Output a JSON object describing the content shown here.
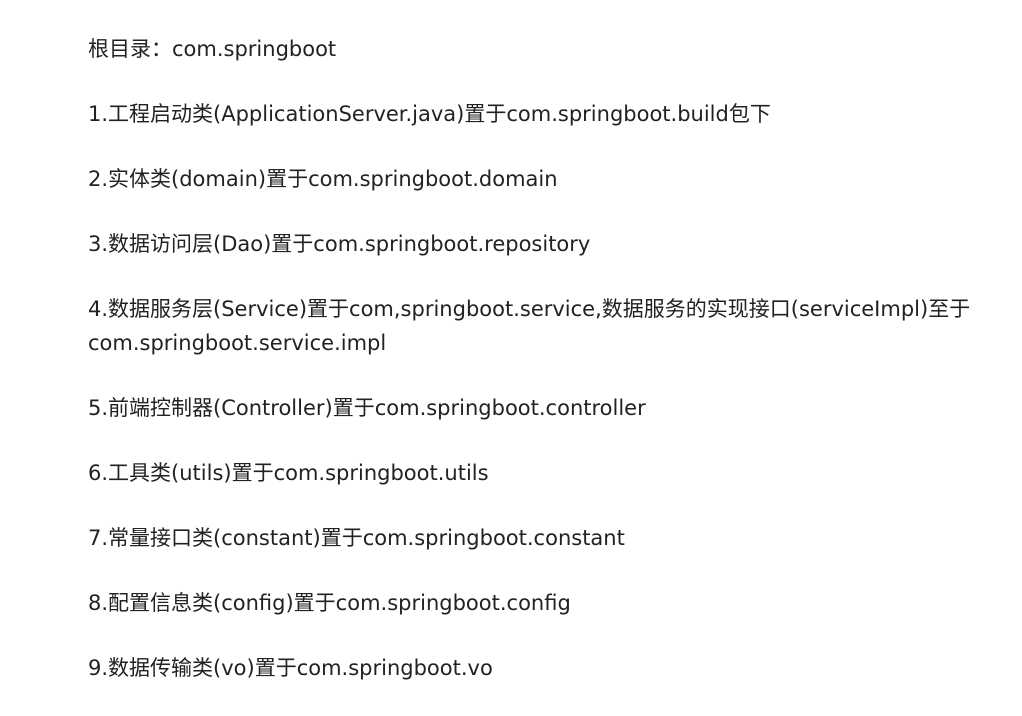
{
  "document": {
    "root_line": "根目录：com.springboot",
    "items": [
      "1.工程启动类(ApplicationServer.java)置于com.springboot.build包下",
      "2.实体类(domain)置于com.springboot.domain",
      "3.数据访问层(Dao)置于com.springboot.repository",
      "4.数据服务层(Service)置于com,springboot.service,数据服务的实现接口(serviceImpl)至于com.springboot.service.impl",
      "5.前端控制器(Controller)置于com.springboot.controller",
      "6.工具类(utils)置于com.springboot.utils",
      "7.常量接口类(constant)置于com.springboot.constant",
      "8.配置信息类(config)置于com.springboot.config",
      "9.数据传输类(vo)置于com.springboot.vo"
    ]
  }
}
